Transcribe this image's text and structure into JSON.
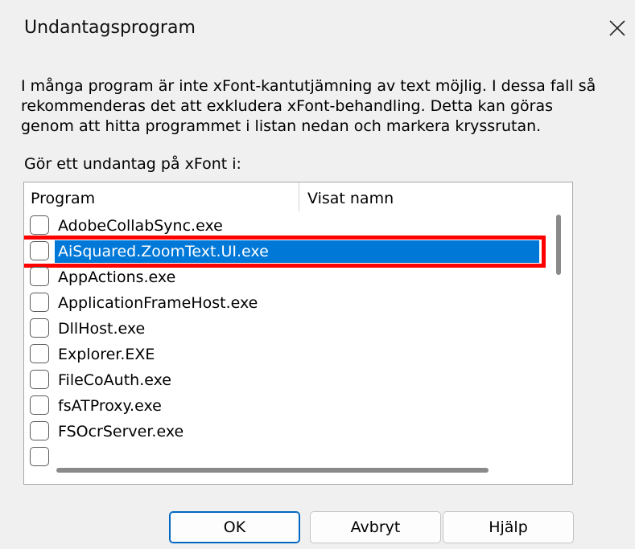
{
  "window": {
    "title": "Undantagsprogram",
    "close_icon": "close-icon"
  },
  "description": {
    "lines": [
      "I många program är inte xFont-kantutjämning av text möjlig. I dessa fall så",
      "rekommenderas det att exkludera xFont-behandling. Detta kan göras",
      "genom att hitta programmet i listan nedan och markera kryssrutan."
    ]
  },
  "list": {
    "label": "Gör ett undantag på xFont i:",
    "columns": [
      "Program",
      "Visat namn"
    ],
    "selected_index": 1,
    "items": [
      {
        "name": "AdobeCollabSync.exe",
        "checked": false
      },
      {
        "name": "AiSquared.ZoomText.UI.exe",
        "checked": false
      },
      {
        "name": "AppActions.exe",
        "checked": false
      },
      {
        "name": "ApplicationFrameHost.exe",
        "checked": false
      },
      {
        "name": "DllHost.exe",
        "checked": false
      },
      {
        "name": "Explorer.EXE",
        "checked": false
      },
      {
        "name": "FileCoAuth.exe",
        "checked": false
      },
      {
        "name": "fsATProxy.exe",
        "checked": false
      },
      {
        "name": "FSOcrServer.exe",
        "checked": false
      },
      {
        "name": "",
        "checked": false
      }
    ]
  },
  "buttons": {
    "ok": "OK",
    "cancel": "Avbryt",
    "help": "Hjälp"
  },
  "colors": {
    "selection": "#0078d7",
    "highlight": "#ff0000"
  }
}
